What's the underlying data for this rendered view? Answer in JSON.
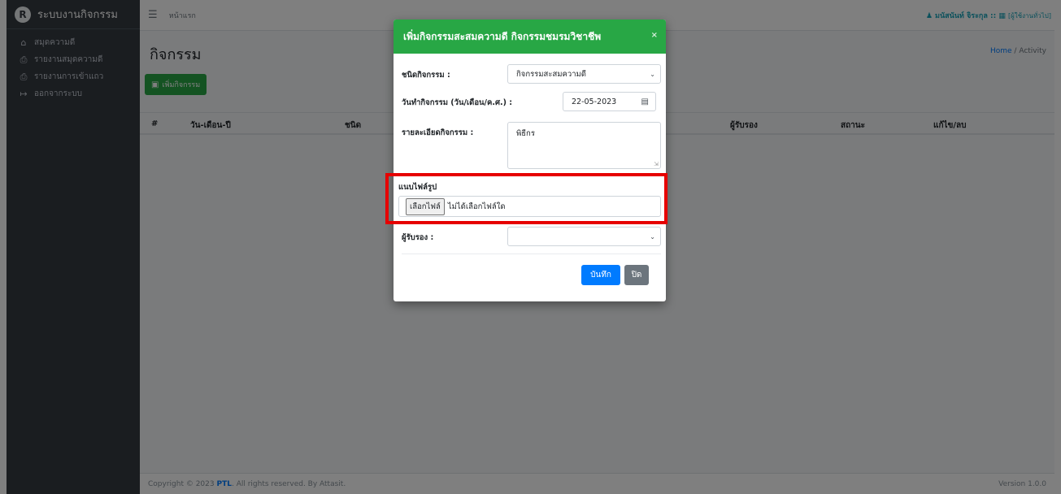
{
  "sidebar": {
    "brand_logo": "R",
    "brand": "ระบบงานกิจกรรม",
    "items": [
      {
        "icon": "home-icon",
        "label": "สมุดความดี"
      },
      {
        "icon": "print-icon",
        "label": "รายงานสมุดความดี"
      },
      {
        "icon": "print-icon",
        "label": "รายงานการเข้าแถว"
      },
      {
        "icon": "sign-out-icon",
        "label": "ออกจากระบบ"
      }
    ]
  },
  "topbar": {
    "menu_icon": "hamburger-icon",
    "home_link": "หน้าแรก",
    "user_name": "มนัสนันท์ จิระกุล ::",
    "user_role": "[ผู้ใช้งานทั่วไป]"
  },
  "page": {
    "title": "กิจกรรม",
    "breadcrumb_home": "Home",
    "breadcrumb_sep": "/",
    "breadcrumb_current": "Activity",
    "add_button": "เพิ่มกิจกรรม",
    "table_headers": [
      "#",
      "วัน-เดือน-ปี",
      "ชนิด",
      "ผู้รับรอง",
      "สถานะ",
      "แก้ไข/ลบ"
    ]
  },
  "footer": {
    "copyright_prefix": "Copyright © 2023",
    "brand_link": "PTL",
    "copyright_suffix": ". All rights reserved. By Attasit.",
    "version": "Version 1.0.0"
  },
  "modal": {
    "title": "เพิ่มกิจกรรมสะสมความดี กิจกรรมชมรมวิชาชีพ",
    "close": "×",
    "type_label": "ชนิดกิจกรรม :",
    "type_value": "กิจกรรมสะสมความดี",
    "date_label": "วันทำกิจกรรม (วัน/เดือน/ค.ศ.) :",
    "date_value": "22-05-2023",
    "detail_label": "รายละเอียดกิจกรรม :",
    "detail_value": "พิธีกร",
    "file_label": "แนบไฟล์รูป",
    "file_button": "เลือกไฟล์",
    "file_status": "ไม่ได้เลือกไฟล์ใด",
    "approver_label": "ผู้รับรอง :",
    "approver_value": "",
    "save_button": "บันทึก",
    "close_button": "ปิด"
  }
}
